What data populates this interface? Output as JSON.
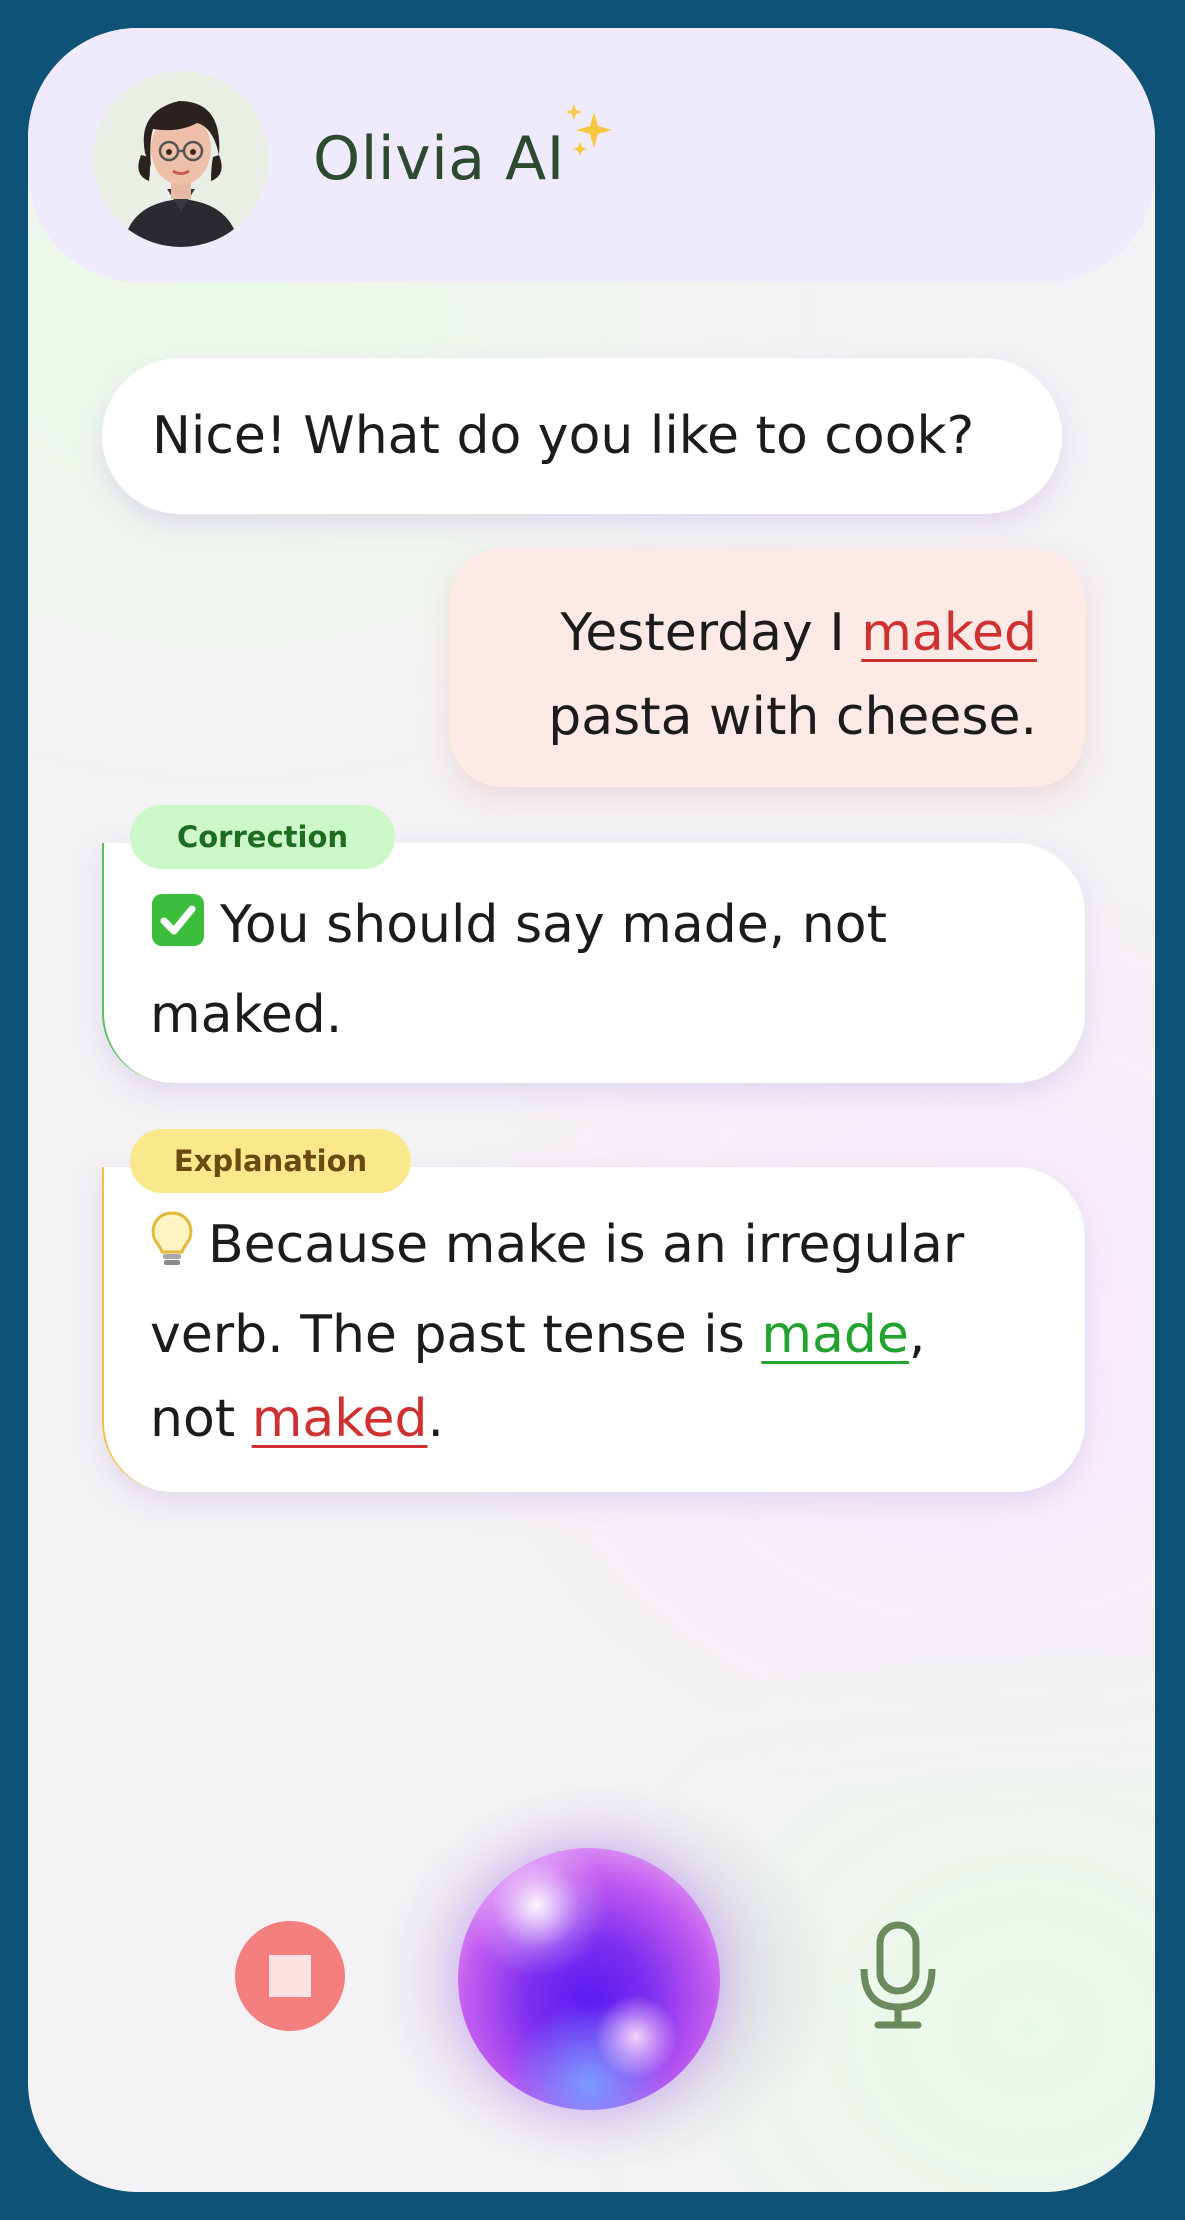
{
  "header": {
    "title": "Olivia AI",
    "avatar_icon": "female-avatar-icon",
    "sparkle_icon": "sparkle-icon",
    "background_color": "#efebfd"
  },
  "messages": {
    "assistant_question": "Nice! What do you like to cook?",
    "user_message": {
      "prefix": "Yesterday I",
      "error_word": "maked",
      "suffix": "pasta with cheese."
    }
  },
  "correction": {
    "tag_label": "Correction",
    "icon": "checkmark-icon",
    "text": "You should say made, not maked.",
    "tag_color": "#ccf7c8"
  },
  "explanation": {
    "tag_label": "Explanation",
    "icon": "lightbulb-icon",
    "text_start": "Because make is an irregular verb. The past tense is",
    "correct_word": "made",
    "comma": ",",
    "not_word": "not",
    "wrong_word": "maked",
    "period": ".",
    "tag_color": "#f9e98c"
  },
  "controls": {
    "stop_icon": "stop-icon",
    "orb": "voice-orb",
    "mic_icon": "microphone-icon"
  },
  "colors": {
    "frame": "#0f5277",
    "error": "#cf3131",
    "correct": "#22a22e",
    "stop": "#f47f7f"
  }
}
